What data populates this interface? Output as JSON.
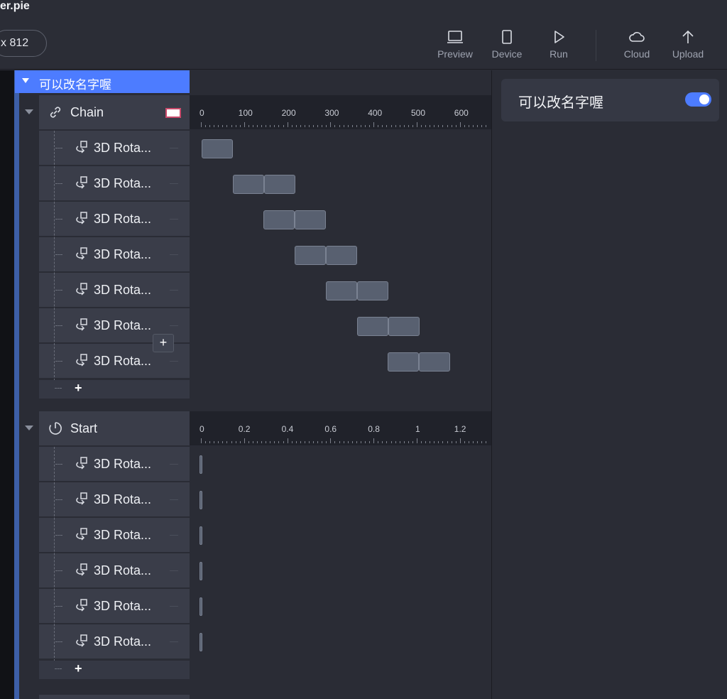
{
  "window": {
    "title": "er.pie"
  },
  "toolbar": {
    "size_label": "x 812",
    "buttons": [
      {
        "label": "Preview",
        "icon": "laptop-icon"
      },
      {
        "label": "Device",
        "icon": "phone-icon"
      },
      {
        "label": "Run",
        "icon": "play-icon"
      },
      {
        "label": "Cloud",
        "icon": "cloud-icon"
      },
      {
        "label": "Upload",
        "icon": "upload-icon"
      }
    ]
  },
  "group": {
    "name": "可以改名字喔"
  },
  "sections": [
    {
      "name": "Chain",
      "icon": "link-icon",
      "swatch_color": "#ffffff",
      "ruler_labels": [
        "0",
        "100",
        "200",
        "300",
        "400",
        "500",
        "600"
      ],
      "rows": [
        {
          "label": "3D Rota..."
        },
        {
          "label": "3D Rota..."
        },
        {
          "label": "3D Rota..."
        },
        {
          "label": "3D Rota..."
        },
        {
          "label": "3D Rota..."
        },
        {
          "label": "3D Rota..."
        },
        {
          "label": "3D Rota..."
        }
      ],
      "add_label": "+"
    },
    {
      "name": "Start",
      "icon": "timer-icon",
      "ruler_labels": [
        "0",
        "0.2",
        "0.4",
        "0.6",
        "0.8",
        "1",
        "1.2"
      ],
      "rows": [
        {
          "label": "3D Rota..."
        },
        {
          "label": "3D Rota..."
        },
        {
          "label": "3D Rota..."
        },
        {
          "label": "3D Rota..."
        },
        {
          "label": "3D Rota..."
        },
        {
          "label": "3D Rota..."
        }
      ],
      "add_label": "+"
    }
  ],
  "floating_add": "+",
  "properties": {
    "name": "可以改名字喔",
    "toggle_on": true
  },
  "colors": {
    "accent": "#4d7cff",
    "background": "#2a2c35",
    "row": "#3a3d49"
  }
}
